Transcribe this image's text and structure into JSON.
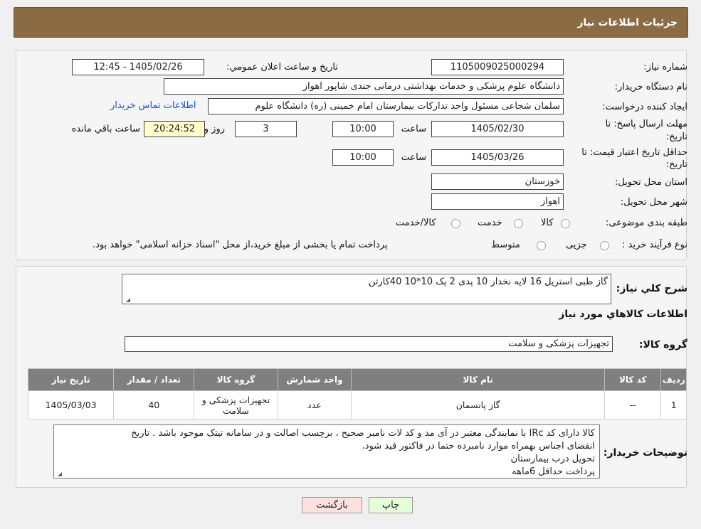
{
  "header": {
    "title": "جزئیات اطلاعات نیاز"
  },
  "watermark": {
    "text": "AriaTender.neT"
  },
  "form": {
    "need_number_label": "شماره نیاز:",
    "need_number": "1105009025000294",
    "announce_label": "تاریخ و ساعت اعلان عمومي:",
    "announce_value": "1405/02/26 - 12:45",
    "buyer_org_label": "نام دستگاه خریدار:",
    "buyer_org": "دانشگاه علوم پزشکی و خدمات بهداشتی درمانی جندی شاپور اهواز",
    "creator_label": "ایجاد کننده درخواست:",
    "creator": "سلمان شجاعی مسئول واحد تدارکات بیمارستان امام خمینی (ره) دانشگاه علوم",
    "contact_link": "اطلاعات تماس خریدار",
    "deadline_label_1": "مهلت ارسال پاسخ: تا",
    "deadline_label_2": "تاریخ:",
    "deadline_date": "1405/02/30",
    "time_label": "ساعت",
    "deadline_time": "10:00",
    "days_value": "3",
    "days_label": "روز و",
    "remaining_time": "20:24:52",
    "remaining_label": "ساعت باقي مانده",
    "validity_label_1": "حداقل تاریخ اعتبار قیمت: تا",
    "validity_label_2": "تاریخ:",
    "validity_date": "1405/03/26",
    "validity_time": "10:00",
    "province_label": "استان محل تحویل:",
    "province": "خوزستان",
    "city_label": "شهر محل تحویل:",
    "city": "اهواز",
    "category_label": "طبقه بندی موضوعی:",
    "category_options": [
      "کالا",
      "خدمت",
      "کالا/خدمت"
    ],
    "process_label": "نوع فرآیند خرید :",
    "process_options": [
      "جزیی",
      "متوسط"
    ],
    "process_note": "پرداخت تمام یا بخشی از مبلغ خرید،از محل \"اسناد خزانه اسلامی\" خواهد بود."
  },
  "summary": {
    "title_label": "شرح کلي نياز:",
    "title_value": "گاز طبی استریل 16 لایه نخدار 10 پدی 2 پک   10*10           40کارتن",
    "goods_info_title": "اطلاعات کالاهاي مورد نياز",
    "group_label": "گروه کالا:",
    "group_value": "تجهیزات پزشکی و سلامت"
  },
  "table": {
    "headers": [
      "رديف",
      "کد کالا",
      "نام کالا",
      "واحد شمارش",
      "گروه کالا",
      "تعداد / مقدار",
      "تاریخ نیاز"
    ],
    "rows": [
      [
        "1",
        "--",
        "گاز پانسمان",
        "عدد",
        "تجهیزات پزشکی و سلامت",
        "40",
        "1405/03/03"
      ]
    ]
  },
  "notes": {
    "label": "توضیحات خریدار:",
    "lines": [
      "کالا دارای کد IRc با نمایندگی معتبر در آی مد و کد لات نامبر صحیح ، برچسب اصالت و در سامانه تیتک موجود باشد . تاریخ",
      "انقضای اجناس بهمراه موارد نامبرده حتما در فاکتور قید شود.",
      "تحویل درب بیمارستان",
      "پرداخت حداقل 6ماهه"
    ]
  },
  "buttons": {
    "print": "چاپ",
    "back": "بازگشت"
  },
  "colors": {
    "header_bg": "#8a6b44",
    "link": "#1a4fd6",
    "table_header": "#7f7f7f",
    "print_btn": "#e6ffd9",
    "back_btn": "#ffe0e0"
  }
}
